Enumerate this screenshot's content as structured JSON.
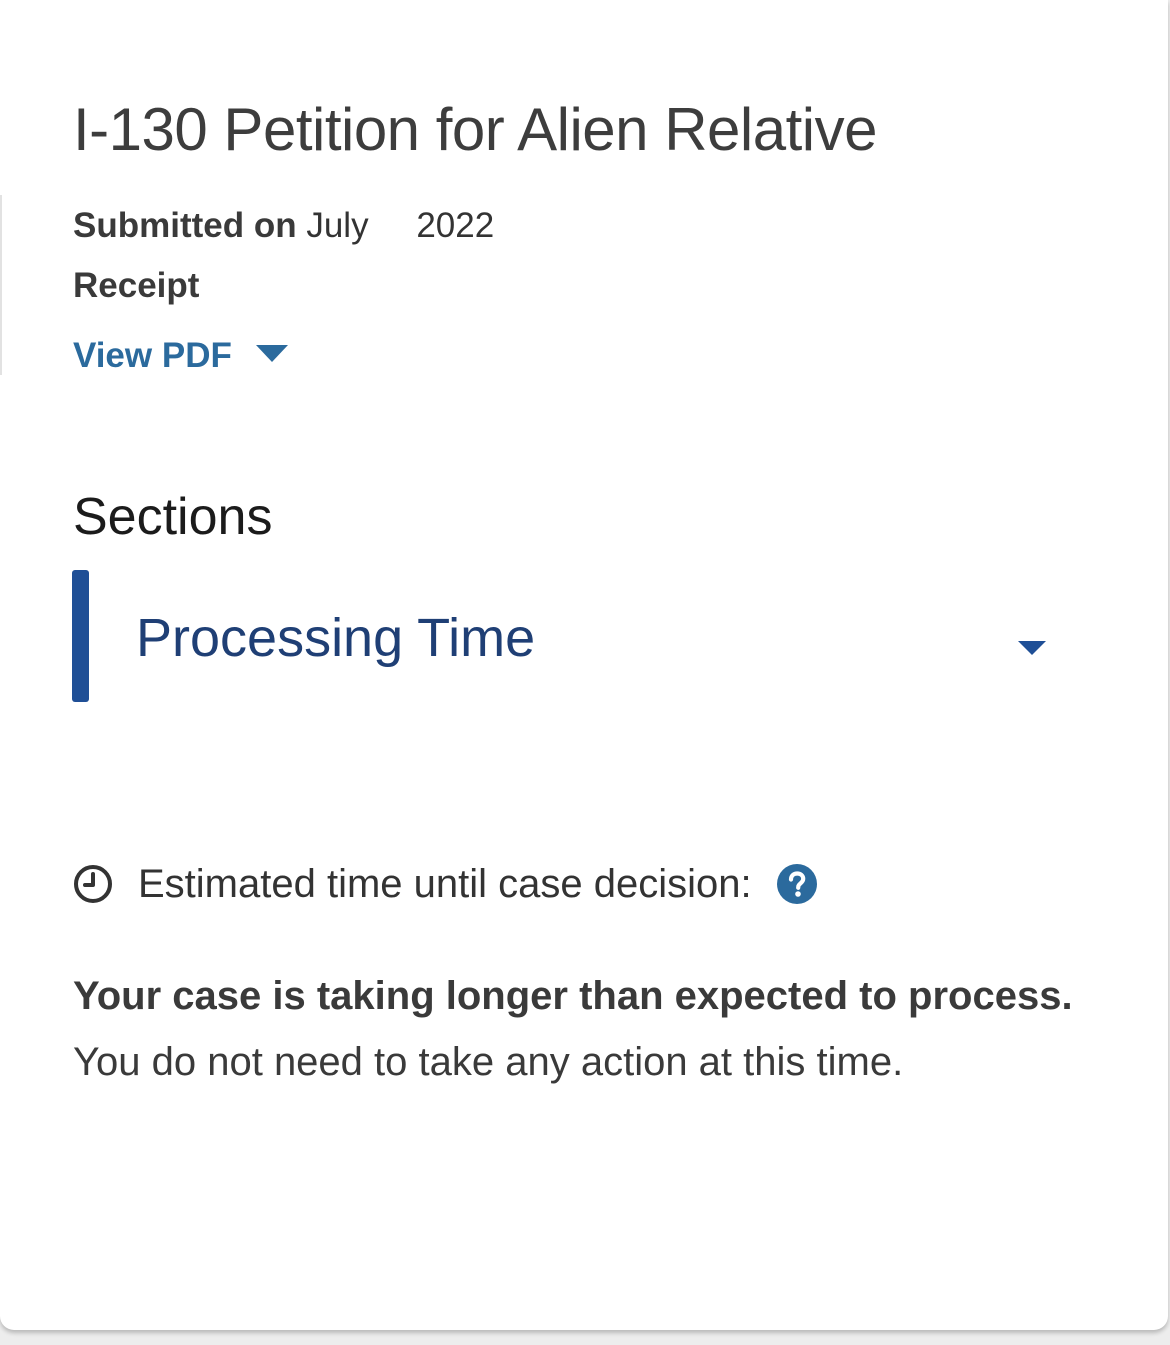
{
  "case": {
    "title": "I-130 Petition for Alien Relative",
    "submitted_label": "Submitted on",
    "submitted_month": "July",
    "submitted_year": "2022",
    "receipt_label": "Receipt",
    "view_pdf_label": "View PDF"
  },
  "sections": {
    "heading": "Sections",
    "items": [
      {
        "label": "Processing Time"
      }
    ]
  },
  "processing": {
    "estimate_label": "Estimated time until case decision:",
    "status_bold": "Your case is taking longer than expected to process.",
    "status_text": " You do not need to take any action at this time."
  },
  "colors": {
    "link_blue": "#2b6a9d",
    "accent_navy": "#1f4f96",
    "heading_navy": "#1f3f75",
    "text_gray": "#3a3a3a"
  },
  "icons": {
    "clock": "clock-icon",
    "help": "help-icon",
    "view_pdf_caret": "caret-down-icon",
    "accordion_caret": "caret-down-icon"
  }
}
